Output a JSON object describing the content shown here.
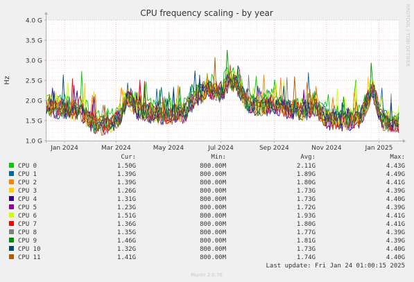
{
  "chart_data": {
    "type": "line",
    "title": "CPU frequency scaling - by year",
    "ylabel": "Hz",
    "watermark": "RRDTOOL / TOBI OETIKER",
    "footer": "Munin 2.0.76",
    "ylim": [
      1.0,
      4.0
    ],
    "y_ticks": [
      {
        "value": 1.0,
        "label": "1.0 G"
      },
      {
        "value": 1.5,
        "label": "1.5 G"
      },
      {
        "value": 2.0,
        "label": "2.0 G"
      },
      {
        "value": 2.5,
        "label": "2.5 G"
      },
      {
        "value": 3.0,
        "label": "3.0 G"
      },
      {
        "value": 3.5,
        "label": "3.5 G"
      },
      {
        "value": 4.0,
        "label": "4.0 G"
      }
    ],
    "x_range": [
      "2023-12-11",
      "2025-01-24"
    ],
    "x_ticks": [
      {
        "date": "2024-01-01",
        "label": "Jan 2024"
      },
      {
        "date": "2024-03-01",
        "label": "Mar 2024"
      },
      {
        "date": "2024-05-01",
        "label": "May 2024"
      },
      {
        "date": "2024-07-01",
        "label": "Jul 2024"
      },
      {
        "date": "2024-09-01",
        "label": "Sep 2024"
      },
      {
        "date": "2024-11-01",
        "label": "Nov 2024"
      },
      {
        "date": "2025-01-01",
        "label": "Jan 2025"
      }
    ],
    "average_profile": [
      [
        "2023-12-11",
        1.85
      ],
      [
        "2024-01-05",
        1.8
      ],
      [
        "2024-01-20",
        1.75
      ],
      [
        "2024-02-05",
        1.4
      ],
      [
        "2024-02-20",
        1.4
      ],
      [
        "2024-03-05",
        1.6
      ],
      [
        "2024-03-15",
        2.1
      ],
      [
        "2024-03-25",
        1.8
      ],
      [
        "2024-04-10",
        1.7
      ],
      [
        "2024-05-01",
        1.65
      ],
      [
        "2024-05-20",
        1.7
      ],
      [
        "2024-06-01",
        2.1
      ],
      [
        "2024-06-15",
        2.3
      ],
      [
        "2024-07-01",
        2.2
      ],
      [
        "2024-07-10",
        2.5
      ],
      [
        "2024-07-20",
        2.4
      ],
      [
        "2024-08-01",
        1.9
      ],
      [
        "2024-08-15",
        1.85
      ],
      [
        "2024-09-01",
        1.9
      ],
      [
        "2024-09-20",
        1.8
      ],
      [
        "2024-10-05",
        1.75
      ],
      [
        "2024-10-20",
        1.85
      ],
      [
        "2024-11-01",
        1.55
      ],
      [
        "2024-11-20",
        1.5
      ],
      [
        "2024-12-10",
        1.55
      ],
      [
        "2024-12-25",
        2.3
      ],
      [
        "2025-01-05",
        1.5
      ],
      [
        "2025-01-24",
        1.45
      ]
    ],
    "columns": [
      "",
      "Cur:",
      "Min:",
      "Avg:",
      "Max:"
    ],
    "series": [
      {
        "name": "CPU 0",
        "color": "#00cc00",
        "cur": "1.50G",
        "min": "800.00M",
        "avg": "2.11G",
        "max": "4.43G"
      },
      {
        "name": "CPU 1",
        "color": "#0066b3",
        "cur": "1.39G",
        "min": "800.00M",
        "avg": "1.89G",
        "max": "4.49G"
      },
      {
        "name": "CPU 2",
        "color": "#ff8000",
        "cur": "1.39G",
        "min": "800.00M",
        "avg": "1.80G",
        "max": "4.41G"
      },
      {
        "name": "CPU 3",
        "color": "#ffcc00",
        "cur": "1.26G",
        "min": "800.00M",
        "avg": "1.73G",
        "max": "4.39G"
      },
      {
        "name": "CPU 4",
        "color": "#330099",
        "cur": "1.31G",
        "min": "800.00M",
        "avg": "1.73G",
        "max": "4.40G"
      },
      {
        "name": "CPU 5",
        "color": "#990099",
        "cur": "1.23G",
        "min": "800.00M",
        "avg": "1.72G",
        "max": "4.39G"
      },
      {
        "name": "CPU 6",
        "color": "#ccff00",
        "cur": "1.51G",
        "min": "800.00M",
        "avg": "1.93G",
        "max": "4.41G"
      },
      {
        "name": "CPU 7",
        "color": "#ff0000",
        "cur": "1.36G",
        "min": "800.00M",
        "avg": "1.80G",
        "max": "4.41G"
      },
      {
        "name": "CPU 8",
        "color": "#808080",
        "cur": "1.35G",
        "min": "800.00M",
        "avg": "1.77G",
        "max": "4.39G"
      },
      {
        "name": "CPU 9",
        "color": "#008f00",
        "cur": "1.46G",
        "min": "800.00M",
        "avg": "1.81G",
        "max": "4.39G"
      },
      {
        "name": "CPU 10",
        "color": "#00487d",
        "cur": "1.32G",
        "min": "800.00M",
        "avg": "1.73G",
        "max": "4.40G"
      },
      {
        "name": "CPU 11",
        "color": "#b35a00",
        "cur": "1.41G",
        "min": "800.00M",
        "avg": "1.74G",
        "max": "4.40G"
      }
    ],
    "last_update": "Last update: Fri Jan 24 01:00:15 2025"
  }
}
